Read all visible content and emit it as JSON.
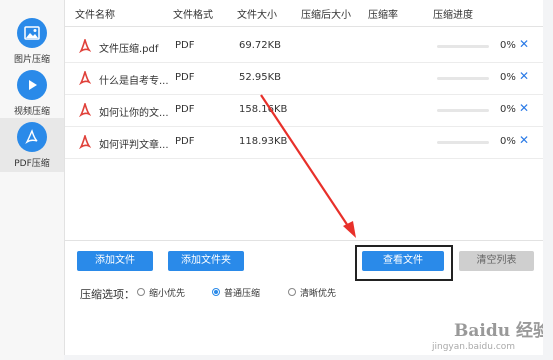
{
  "sidebar": {
    "items": [
      {
        "label": "图片压缩",
        "icon": "image-icon",
        "active": false
      },
      {
        "label": "视频压缩",
        "icon": "play-icon",
        "active": false
      },
      {
        "label": "PDF压缩",
        "icon": "pdf-icon",
        "active": true
      }
    ]
  },
  "table": {
    "headers": [
      "文件名称",
      "文件格式",
      "文件大小",
      "压缩后大小",
      "压缩率",
      "压缩进度"
    ],
    "rows": [
      {
        "name": "文件压缩.pdf",
        "format": "PDF",
        "size": "69.72KB",
        "compressed": "",
        "ratio": "",
        "progress": 0,
        "progress_text": "0%"
      },
      {
        "name": "什么是自考专...",
        "format": "PDF",
        "size": "52.95KB",
        "compressed": "",
        "ratio": "",
        "progress": 0,
        "progress_text": "0%"
      },
      {
        "name": "如何让你的文...",
        "format": "PDF",
        "size": "158.16KB",
        "compressed": "",
        "ratio": "",
        "progress": 0,
        "progress_text": "0%"
      },
      {
        "name": "如何评判文章...",
        "format": "PDF",
        "size": "118.93KB",
        "compressed": "",
        "ratio": "",
        "progress": 0,
        "progress_text": "0%"
      }
    ]
  },
  "buttons": {
    "add_file": "添加文件",
    "add_folder": "添加文件夹",
    "view_files": "查看文件",
    "clear_list": "清空列表"
  },
  "options": {
    "label": "压缩选项：",
    "choices": [
      "缩小优先",
      "普通压缩",
      "清晰优先"
    ],
    "selected": "普通压缩"
  },
  "watermark": {
    "brand": "Baidu 经验",
    "url": "jingyan.baidu.com"
  },
  "colors": {
    "accent": "#2a8ae9",
    "arrow": "#e8302a",
    "pdf_icon": "#e0413a"
  }
}
